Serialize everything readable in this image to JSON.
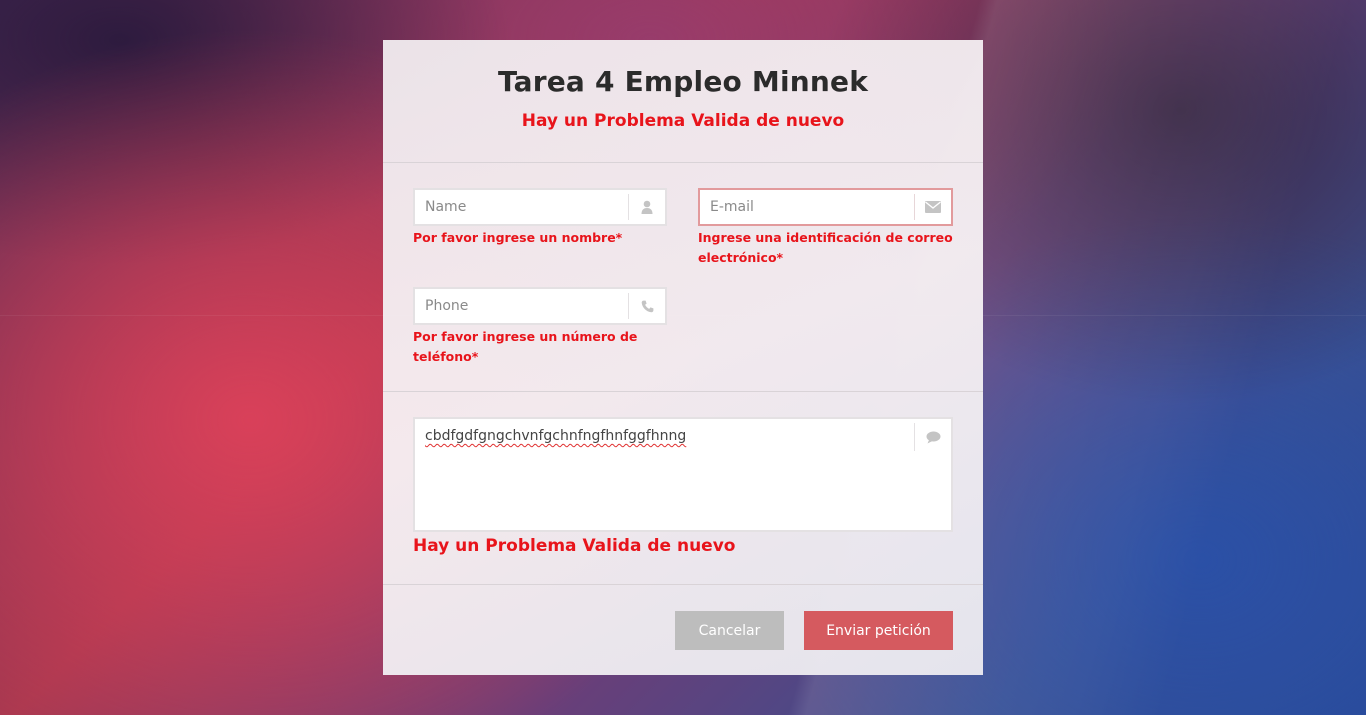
{
  "header": {
    "title": "Tarea 4 Empleo Minnek",
    "error_banner": "Hay un Problema Valida de nuevo"
  },
  "fields": {
    "name": {
      "placeholder": "Name",
      "value": "",
      "icon": "user-icon",
      "error": "Por favor ingrese un nombre*"
    },
    "email": {
      "placeholder": "E-mail",
      "value": "",
      "icon": "envelope-icon",
      "error": "Ingrese una identificación de correo electrónico*"
    },
    "phone": {
      "placeholder": "Phone",
      "value": "",
      "icon": "phone-icon",
      "error": "Por favor ingrese un número de teléfono*"
    },
    "message": {
      "value": "cbdfgdfgngchvnfgchnfngfhnfggfhnng",
      "icon": "comment-icon",
      "error": "Hay un Problema Valida de nuevo"
    }
  },
  "buttons": {
    "cancel_label": "Cancelar",
    "submit_label": "Enviar petición"
  },
  "colors": {
    "error_text": "#e8141b",
    "submit_button": "#d55a5f",
    "cancel_button": "#bdbdbd",
    "error_border": "#e29a9c"
  }
}
